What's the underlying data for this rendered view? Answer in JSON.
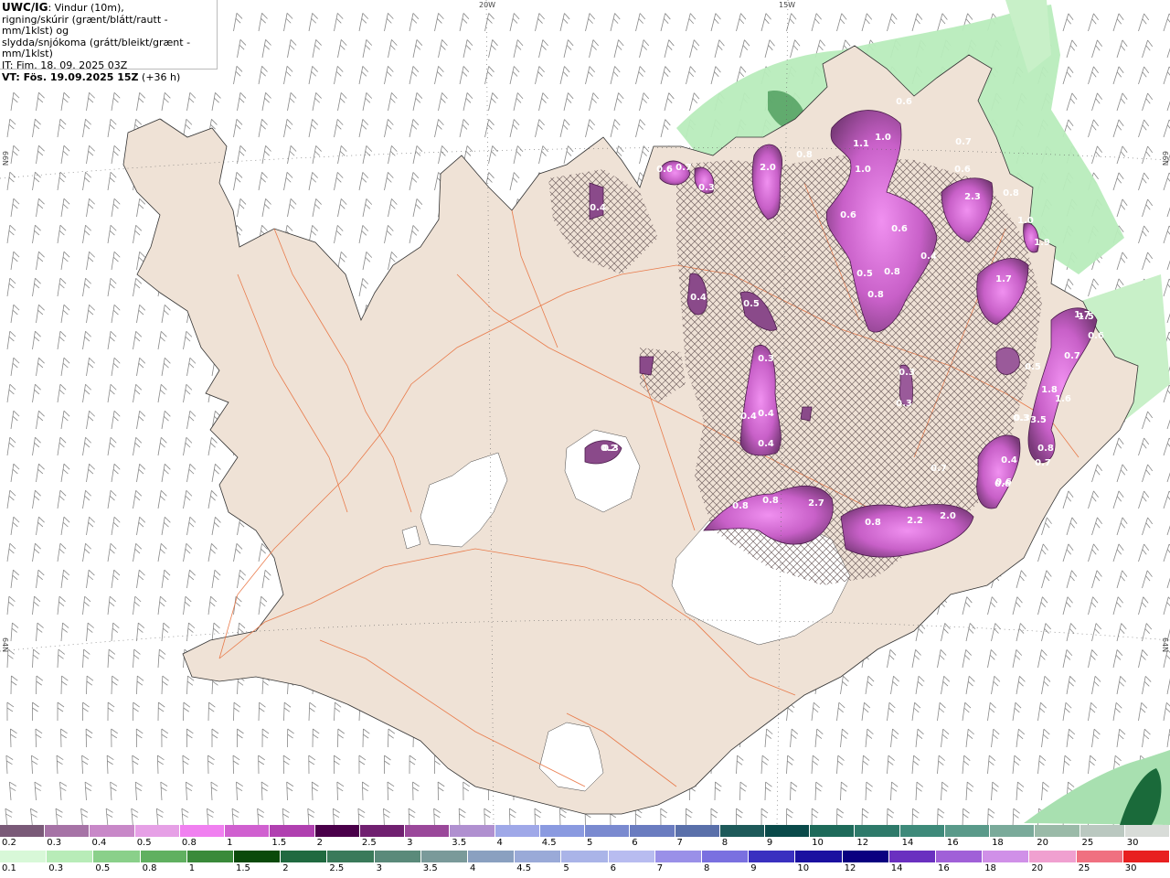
{
  "header": {
    "model": "UWC/IG",
    "description_line1": ": Vindur (10m),",
    "description_line2": "rigning/skúrir (grænt/blátt/rautt - mm/1klst) og",
    "description_line3": "slydda/snjókoma (grátt/bleikt/grænt - mm/1klst)",
    "issue_time": "IT: Fim. 18. 09. 2025 03Z",
    "valid_time": "VT: Fös. 19.09.2025 15Z",
    "lead_time": "(+36 h)"
  },
  "graticule": {
    "lon_labels": [
      "20W",
      "15W"
    ],
    "lat_labels_left": [
      "66N",
      "64N"
    ],
    "lat_labels_right": [
      "66N",
      "64N"
    ]
  },
  "precip_labels": [
    "0.6",
    "0.7",
    "0.3",
    "2.0",
    "0.8",
    "0.4",
    "1.1",
    "1.0",
    "1.0",
    "0.6",
    "0.6",
    "0.7",
    "2.3",
    "0.8",
    "1.0",
    "0.6",
    "0.6",
    "0.4",
    "0.5",
    "0.8",
    "0.8",
    "1.9",
    "1.7",
    "0.4",
    "0.5",
    "0.3",
    "0.4",
    "0.4",
    "0.4",
    "0.3",
    "0.3",
    "0.2",
    "0.3",
    "0.8",
    "0.8",
    "2.7",
    "0.8",
    "2.2",
    "2.0",
    "0.7",
    "0.4",
    "0.6",
    "3.5",
    "1.8",
    "0.7",
    "0.5",
    "1.7",
    "0.6",
    "1.6",
    "0.7",
    "0.3",
    "0.6",
    "0.8",
    "1.5",
    "0.3"
  ],
  "snow_scale": {
    "labels": [
      "0.2",
      "0.3",
      "0.4",
      "0.5",
      "0.8",
      "1",
      "1.5",
      "2",
      "2.5",
      "3",
      "3.5",
      "4",
      "4.5",
      "5",
      "6",
      "7",
      "8",
      "9",
      "10",
      "12",
      "14",
      "16",
      "18",
      "20",
      "25",
      "30"
    ],
    "colors": [
      "#7a5a78",
      "#a673a6",
      "#c888c8",
      "#e6a0e6",
      "#f080f0",
      "#d060d0",
      "#b040b0",
      "#4a004a",
      "#702070",
      "#9a489a",
      "#b090d0",
      "#9fa8e8",
      "#8a9ae0",
      "#7a8ad0",
      "#6a7cc0",
      "#5a70aa",
      "#1e5a5a",
      "#0a4a4a",
      "#1e6a5a",
      "#2e7a6a",
      "#3e8a7a",
      "#5a9a8a",
      "#7aaa9a",
      "#9abaa8",
      "#bac8c0",
      "#d8dcd8"
    ]
  },
  "rain_scale": {
    "labels": [
      "0.1",
      "0.3",
      "0.5",
      "0.8",
      "1",
      "1.5",
      "2",
      "2.5",
      "3",
      "3.5",
      "4",
      "4.5",
      "5",
      "6",
      "7",
      "8",
      "9",
      "10",
      "12",
      "14",
      "16",
      "18",
      "20",
      "25",
      "30"
    ],
    "colors": [
      "#d8f8d8",
      "#b8ecb8",
      "#8ad08a",
      "#60b060",
      "#3a8a3a",
      "#0a4a0a",
      "#206a40",
      "#3a7a5a",
      "#5a8a7a",
      "#7a9a9a",
      "#8aa0c0",
      "#9aaad8",
      "#aab4e8",
      "#b8bcf0",
      "#9a90e8",
      "#7a70e0",
      "#3a30c0",
      "#1a10a0",
      "#0a0080",
      "#6a30c0",
      "#a060d8",
      "#d090e8",
      "#f0a0d0",
      "#f07080",
      "#e82020"
    ]
  },
  "colors": {
    "land": "#efe2d6",
    "ocean": "#ffffff",
    "roads": "#e8703c",
    "coast": "#333333",
    "glacier": "#ffffff",
    "wind_barb": "#888888",
    "rain_green": "#a8e8b0",
    "snow_magenta": "#d668d6"
  },
  "icons": [
    "wind-barb-icon"
  ]
}
